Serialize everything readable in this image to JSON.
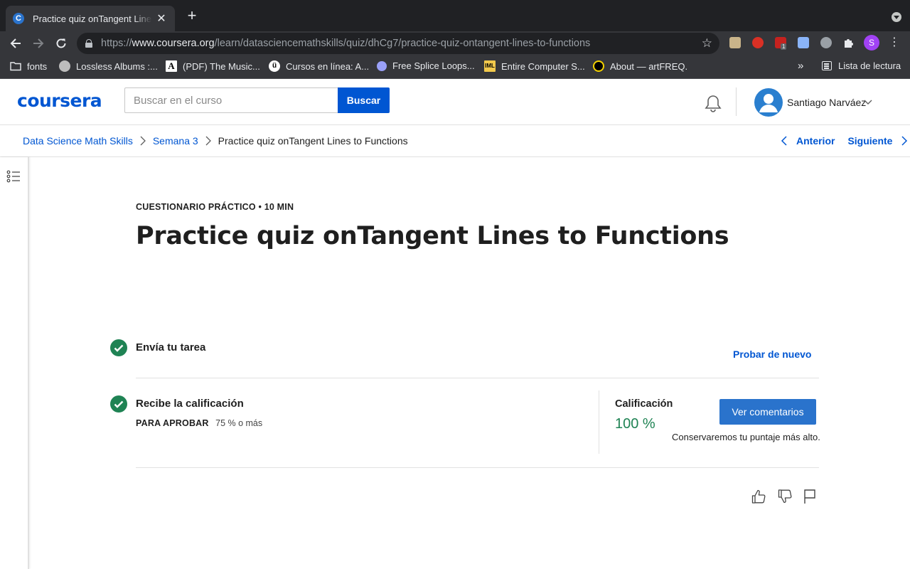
{
  "browser": {
    "tab_title": "Practice quiz onTangent Lines to Functions | Coursera",
    "tab_favicon_letter": "C",
    "url_prefix": "https://",
    "url_domain": "www.coursera.org",
    "url_path": "/learn/datasciencemathskills/quiz/dhCg7/practice-quiz-ontangent-lines-to-functions",
    "profile_initial": "S",
    "extension_badge": "1",
    "bookmarks": [
      {
        "label": "fonts",
        "icon": "folder-icon"
      },
      {
        "label": "Lossless Albums :...",
        "icon": "globe-icon"
      },
      {
        "label": "(PDF) The Music...",
        "icon": "academia-icon"
      },
      {
        "label": "Cursos en línea: A...",
        "icon": "udemy-icon"
      },
      {
        "label": "Free Splice Loops...",
        "icon": "splice-icon"
      },
      {
        "label": "Entire Computer S...",
        "icon": "iml-icon"
      },
      {
        "label": "About — artFREQ.",
        "icon": "artfreq-icon"
      }
    ],
    "bookmarks_overflow": "»",
    "reading_list": "Lista de lectura"
  },
  "header": {
    "logo": "coursera",
    "search_placeholder": "Buscar en el curso",
    "search_button": "Buscar",
    "user_name": "Santiago Narváez"
  },
  "breadcrumb": {
    "items": [
      "Data Science Math Skills",
      "Semana 3",
      "Practice quiz onTangent Lines to Functions"
    ],
    "prev": "Anterior",
    "next": "Siguiente"
  },
  "main": {
    "eyebrow": "CUESTIONARIO PRÁCTICO • 10 MIN",
    "title": "Practice quiz onTangent Lines to Functions",
    "submit_step": "Envía tu tarea",
    "retry": "Probar de nuevo",
    "grade_step": "Recibe la calificación",
    "pass_label": "PARA APROBAR",
    "pass_value": "75 % o más",
    "grade_label": "Calificación",
    "grade_value": "100 %",
    "feedback_button": "Ver comentarios",
    "keep_note": "Conservaremos tu puntaje más alto."
  },
  "colors": {
    "brand_blue": "#0056d2",
    "success_green": "#1f8354",
    "button_blue": "#2a73cc"
  }
}
